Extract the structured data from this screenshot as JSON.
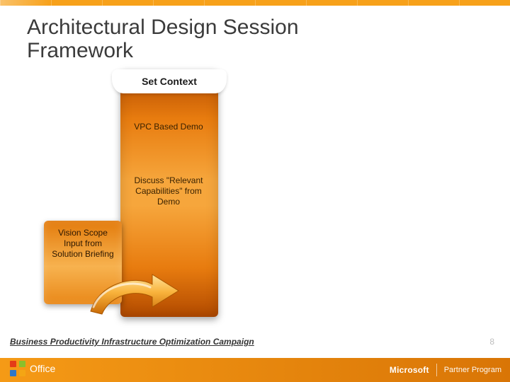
{
  "title": "Architectural Design Session Framework",
  "column": {
    "header": "Set Context",
    "vpc": "VPC Based Demo",
    "discuss": "Discuss \"Relevant Capabilities\" from Demo"
  },
  "side_card": "Vision Scope Input from Solution Briefing",
  "footer": "Business Productivity Infrastructure Optimization Campaign",
  "page_number": "8",
  "bottom_bar": {
    "brand": "Microsoft",
    "program": "Partner Program"
  },
  "office_brand": "Office"
}
